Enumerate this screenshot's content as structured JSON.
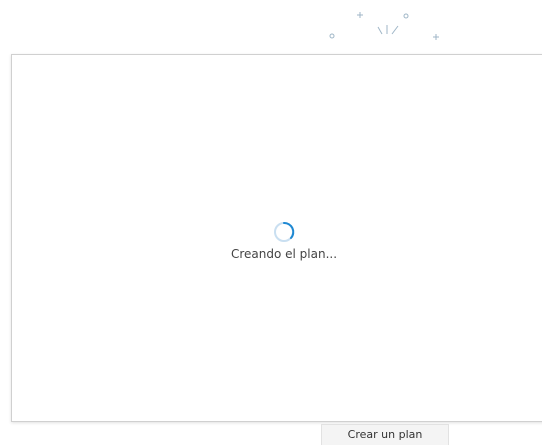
{
  "loading": {
    "message": "Creando el plan..."
  },
  "footer": {
    "create_plan_label": "Crear un plan"
  },
  "colors": {
    "accent": "#1e88d2",
    "spinner_track": "#c9dff1",
    "decoration": "#9fb6c7",
    "dialog_border": "#d0d0d0"
  },
  "icons": {
    "spinner": "loading-spinner-icon",
    "decoration": "celebration-sparkle-icon"
  }
}
